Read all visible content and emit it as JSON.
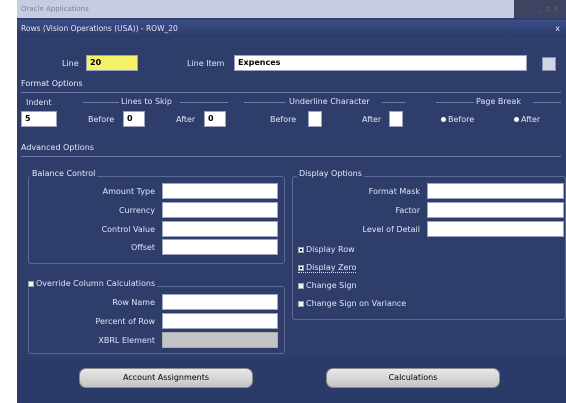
{
  "outer_window": {
    "title": "Oracle Applications",
    "controls": "_ ▫ x"
  },
  "window": {
    "title": "Rows (Vision Operations (USA)) - ROW_20",
    "close_glyph": "x"
  },
  "header": {
    "line_label": "Line",
    "line_value": "20",
    "line_item_label": "Line Item",
    "line_item_value": "Expences"
  },
  "format_options": {
    "title": "Format Options",
    "indent_label": "Indent",
    "indent_value": "5",
    "lines_to_skip_label": "Lines to Skip",
    "before_label": "Before",
    "before_value": "0",
    "after_label": "After",
    "after_value": "0",
    "underline_label": "Underline Character",
    "ul_before_label": "Before",
    "ul_after_label": "After",
    "page_break_label": "Page Break",
    "pb_before_label": "Before",
    "pb_after_label": "After"
  },
  "advanced": {
    "title": "Advanced Options",
    "balance_control": {
      "title": "Balance Control",
      "fields": [
        {
          "label": "Amount Type",
          "value": ""
        },
        {
          "label": "Currency",
          "value": ""
        },
        {
          "label": "Control Value",
          "value": ""
        },
        {
          "label": "Offset",
          "value": ""
        }
      ]
    },
    "override_label": "Override Column Calculations",
    "override_fields": [
      {
        "label": "Row Name",
        "value": ""
      },
      {
        "label": "Percent of Row",
        "value": ""
      },
      {
        "label": "XBRL Element",
        "value": ""
      }
    ],
    "display_options": {
      "title": "Display Options",
      "fields": [
        {
          "label": "Format Mask",
          "value": ""
        },
        {
          "label": "Factor",
          "value": ""
        },
        {
          "label": "Level of Detail",
          "value": ""
        }
      ],
      "checks": [
        {
          "label": "Display Row",
          "checked": true
        },
        {
          "label": "Display Zero",
          "checked": true
        },
        {
          "label": "Change Sign",
          "checked": false
        },
        {
          "label": "Change Sign on Variance",
          "checked": false
        }
      ]
    }
  },
  "buttons": {
    "account_assignments": "Account Assignments",
    "calculations": "Calculations"
  }
}
